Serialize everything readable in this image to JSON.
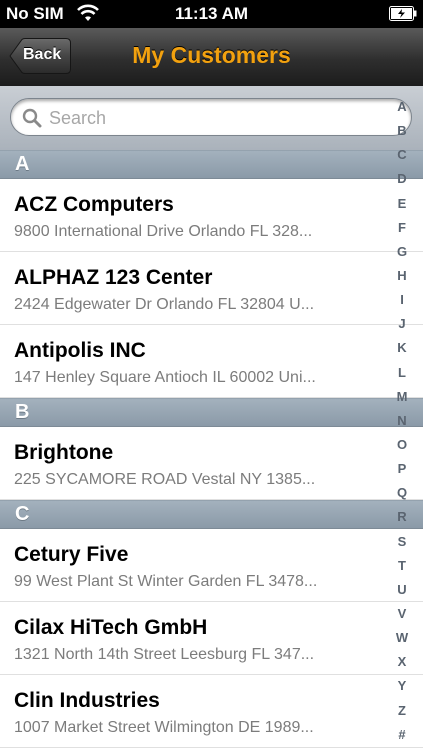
{
  "status_bar": {
    "carrier": "No SIM",
    "time": "11:13 AM"
  },
  "nav": {
    "back_label": "Back",
    "title": "My Customers"
  },
  "search": {
    "placeholder": "Search"
  },
  "sections": [
    {
      "letter": "A",
      "rows": [
        {
          "name": "ACZ Computers",
          "address": "9800 International Drive Orlando FL 328..."
        },
        {
          "name": "ALPHAZ 123 Center",
          "address": "2424 Edgewater Dr Orlando FL 32804 U..."
        },
        {
          "name": "Antipolis INC",
          "address": "147 Henley Square Antioch IL 60002 Uni..."
        }
      ]
    },
    {
      "letter": "B",
      "rows": [
        {
          "name": "Brightone",
          "address": "225 SYCAMORE ROAD Vestal NY 1385..."
        }
      ]
    },
    {
      "letter": "C",
      "rows": [
        {
          "name": "Cetury Five",
          "address": "99 West Plant St Winter Garden FL 3478..."
        },
        {
          "name": "Cilax HiTech GmbH",
          "address": "1321 North 14th Street Leesburg FL 347..."
        },
        {
          "name": "Clin Industries",
          "address": "1007 Market Street Wilmington DE 1989..."
        }
      ]
    }
  ],
  "index_letters": [
    "A",
    "B",
    "C",
    "D",
    "E",
    "F",
    "G",
    "H",
    "I",
    "J",
    "K",
    "L",
    "M",
    "N",
    "O",
    "P",
    "Q",
    "R",
    "S",
    "T",
    "U",
    "V",
    "W",
    "X",
    "Y",
    "Z",
    "#"
  ]
}
